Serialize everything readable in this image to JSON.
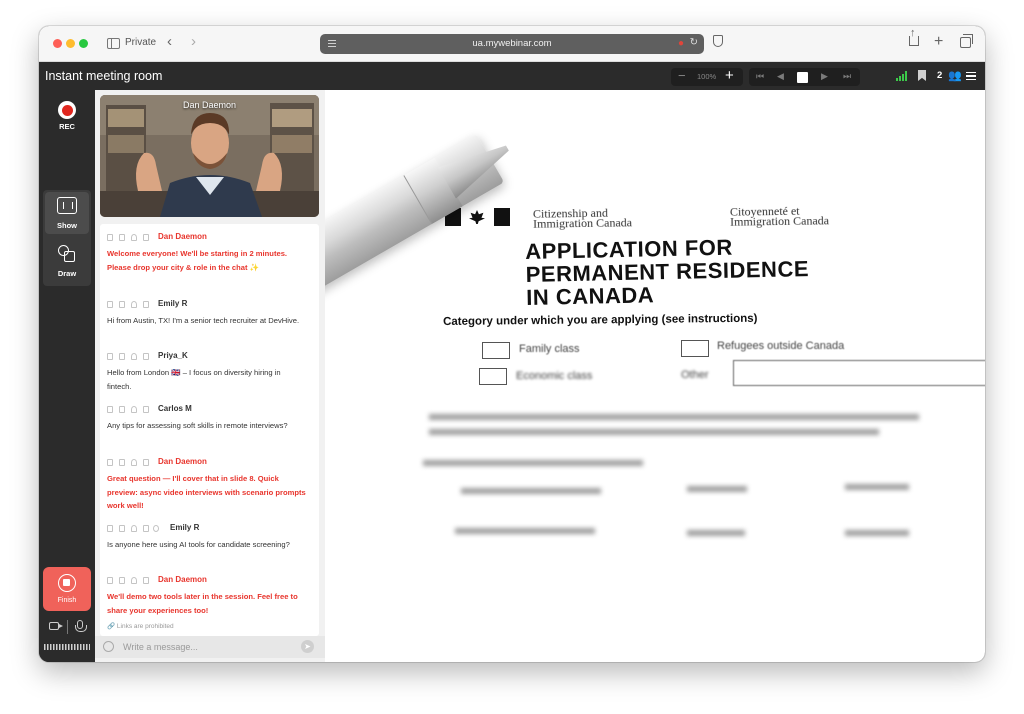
{
  "browser": {
    "private_label": "Private",
    "url": "ua.mywebinar.com"
  },
  "header": {
    "title": "Instant meeting room",
    "zoom": "100%",
    "participant_count": "2"
  },
  "rail": {
    "rec_label": "REC",
    "show_label": "Show",
    "draw_label": "Draw",
    "finish_label": "Finish"
  },
  "video": {
    "name": "Dan Daemon"
  },
  "chat": {
    "messages": [
      {
        "author": "Dan Daemon",
        "text": "Welcome everyone! We'll be starting in 2 minutes. Please drop your city & role in the chat ✨"
      },
      {
        "author": "Emily R",
        "text": "Hi from Austin, TX! I'm a senior tech recruiter at DevHive."
      },
      {
        "author": "Priya_K",
        "text": "Hello from London 🇬🇧 – I focus on diversity hiring in fintech."
      },
      {
        "author": "Carlos M",
        "text": "Any tips for assessing soft skills in remote interviews?"
      },
      {
        "author": "Dan Daemon",
        "text": "Great question — I'll cover that in slide 8. Quick preview: async video interviews with scenario prompts work well!"
      },
      {
        "author": "Emily R",
        "text": "Is anyone here using AI tools for candidate screening?"
      },
      {
        "author": "Dan Daemon",
        "text": "We'll demo two tools later in the session. Feel free to share your experiences too!"
      }
    ],
    "links_note": "Links are prohibited",
    "input_placeholder": "Write a message..."
  },
  "slide": {
    "agency_en_1": "Citizenship and",
    "agency_en_2": "Immigration Canada",
    "agency_fr_1": "Citoyenneté et",
    "agency_fr_2": "Immigration Canada",
    "title_1": "APPLICATION FOR",
    "title_2": "PERMANENT RESIDENCE",
    "title_3": "IN CANADA",
    "subtitle": "Category under which you are applying (see instructions)",
    "option_1": "Family class",
    "option_2": "Refugees outside Canada",
    "option_3": "Economic class",
    "option_4": "Other"
  },
  "colors": {
    "host_text": "#e8352d",
    "finish_button": "#f0625a",
    "signal": "#3cc94a"
  }
}
